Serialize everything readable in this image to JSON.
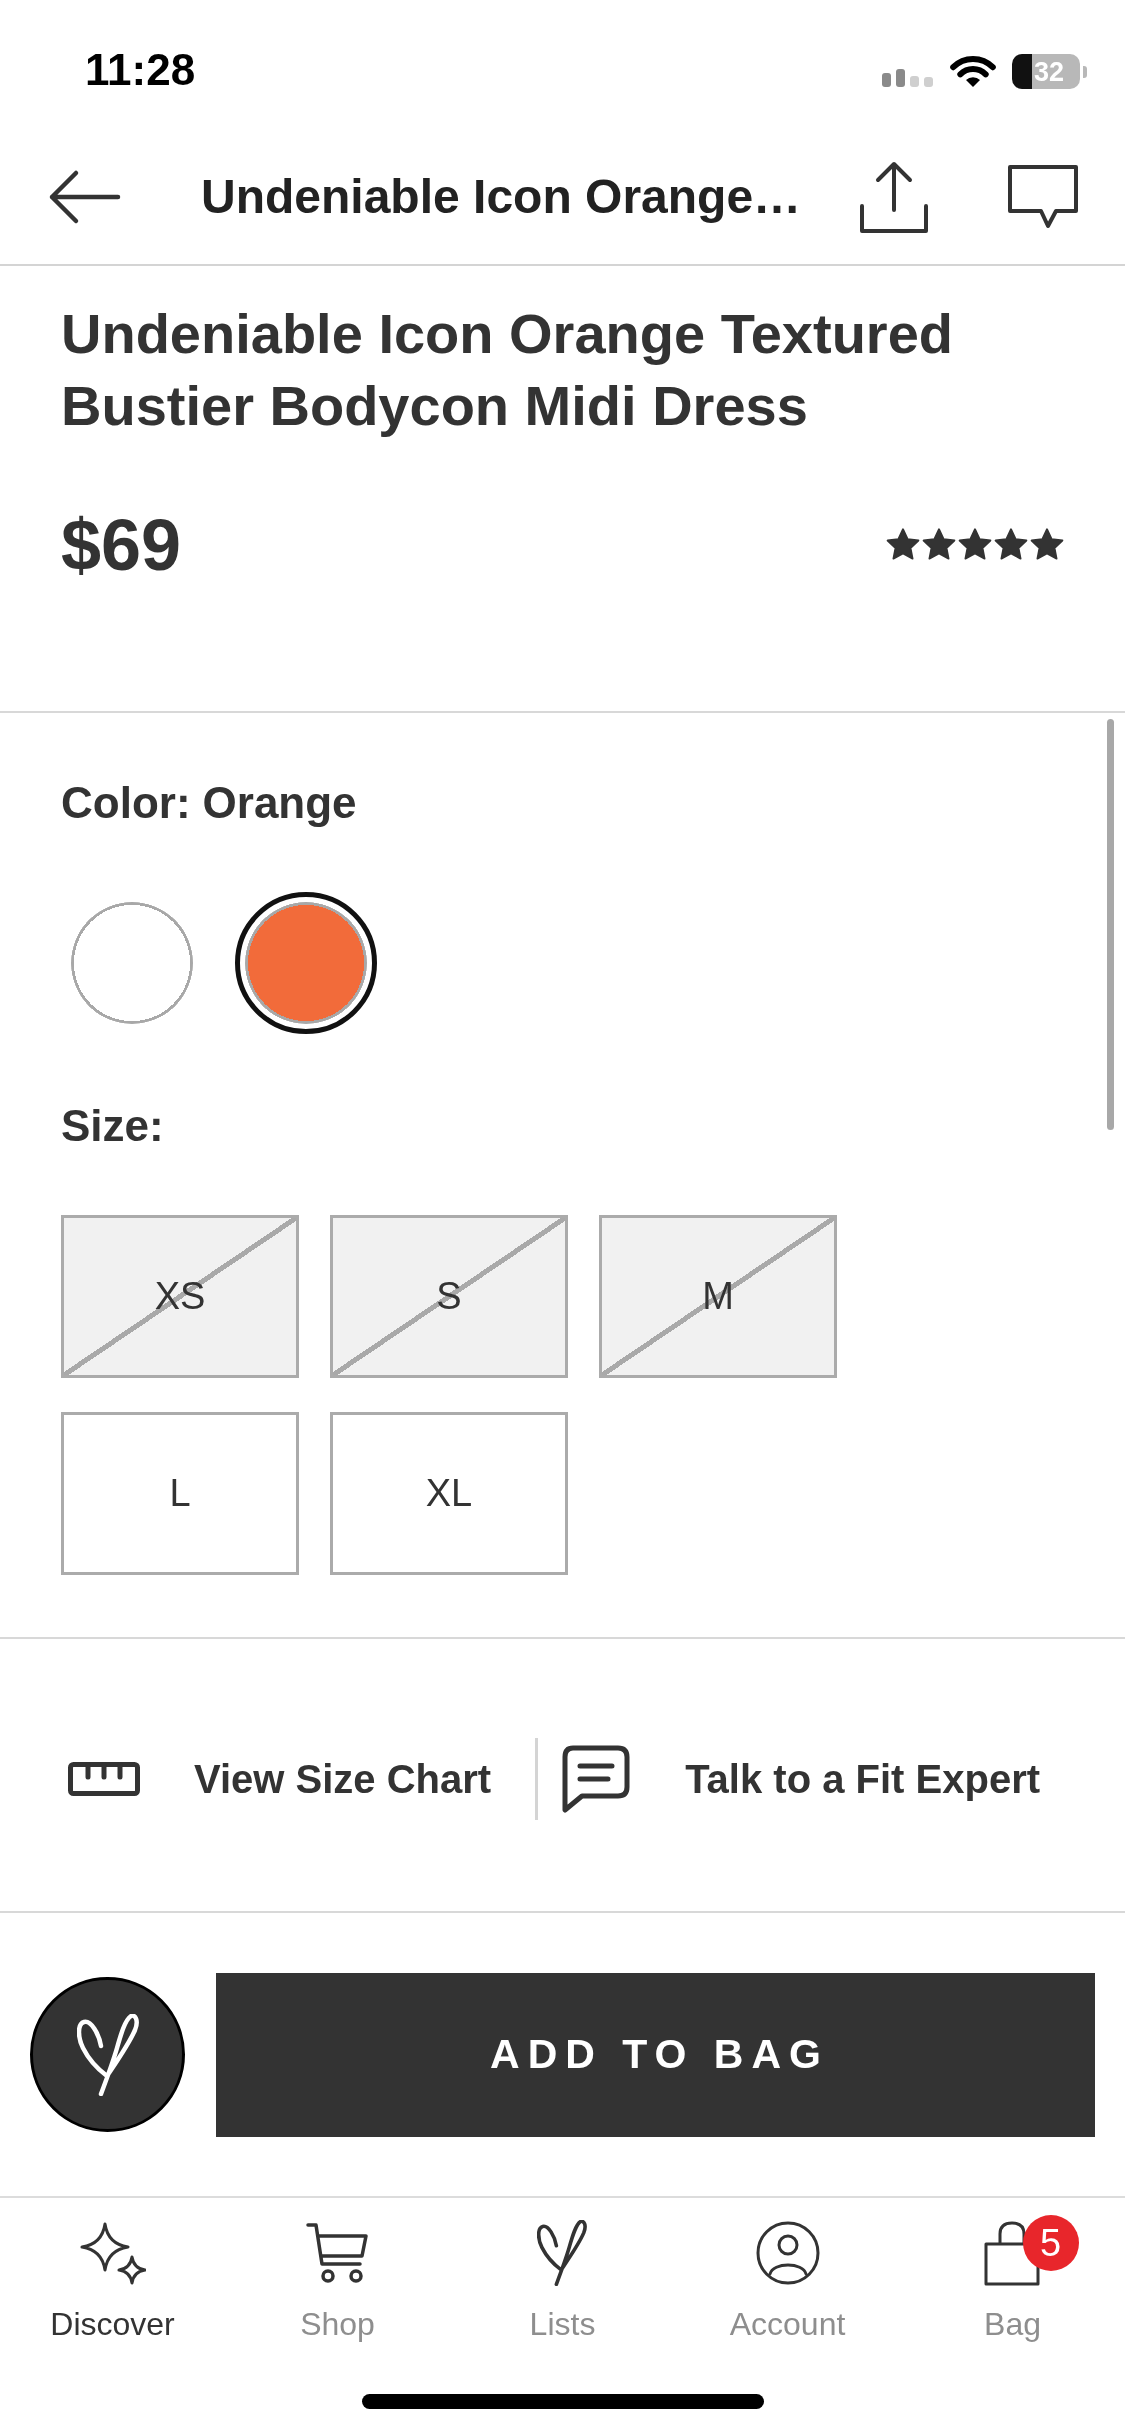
{
  "status_bar": {
    "time": "11:28",
    "battery": "32"
  },
  "nav_bar": {
    "title": "Undeniable Icon Orange…"
  },
  "product": {
    "title": "Undeniable Icon Orange Textured Bustier Bodycon Midi Dress",
    "price": "$69",
    "stars": 5
  },
  "color_picker": {
    "label": "Color:",
    "value": "Orange",
    "swatches": [
      {
        "color": "#ffffff",
        "selected": false
      },
      {
        "color": "#f26b3a",
        "selected": true
      }
    ]
  },
  "size_picker": {
    "label": "Size:",
    "sizes": [
      {
        "label": "XS",
        "disabled": true,
        "selected": false
      },
      {
        "label": "S",
        "disabled": true,
        "selected": false
      },
      {
        "label": "M",
        "disabled": true,
        "selected": false
      },
      {
        "label": "L",
        "disabled": false,
        "selected": false
      },
      {
        "label": "XL",
        "disabled": false,
        "selected": false
      }
    ]
  },
  "fit_links": [
    {
      "kind": "ruler",
      "label": "View Size Chart"
    },
    {
      "kind": "chat",
      "label": "Talk to a Fit Expert"
    }
  ],
  "buy_bar": {
    "add_label": "ADD TO BAG"
  },
  "tab_bar": [
    {
      "kind": "sparkle",
      "label": "Discover",
      "selected": true
    },
    {
      "kind": "cart",
      "label": "Shop",
      "selected": false
    },
    {
      "kind": "heart",
      "label": "Lists",
      "selected": false
    },
    {
      "kind": "person",
      "label": "Account",
      "selected": false
    },
    {
      "kind": "bag",
      "label": "Bag",
      "selected": false,
      "badge": "5"
    }
  ]
}
